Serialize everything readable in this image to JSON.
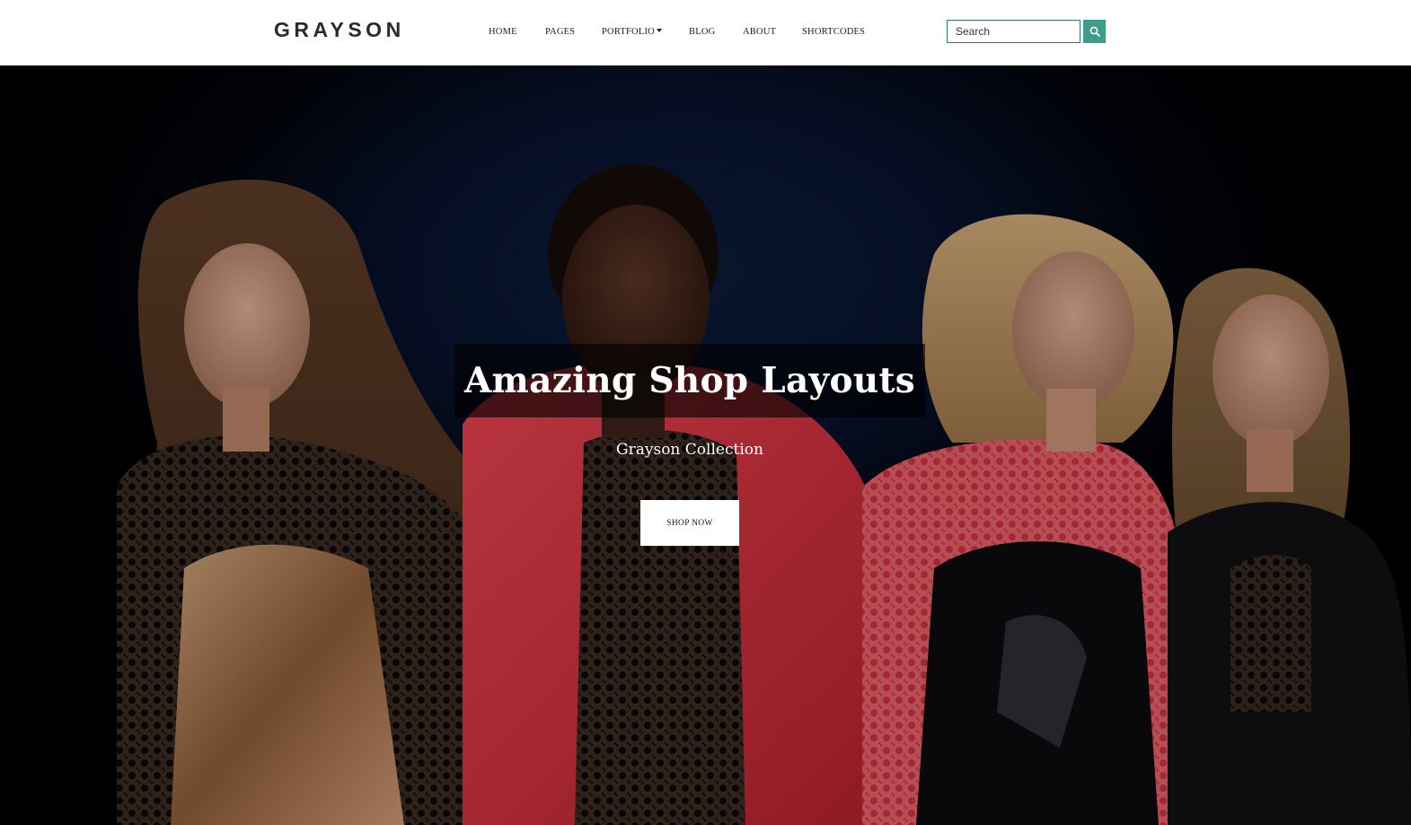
{
  "brand": {
    "logo": "GRAYSON"
  },
  "nav": {
    "items": [
      {
        "label": "HOME"
      },
      {
        "label": "PAGES"
      },
      {
        "label": "PORTFOLIO"
      },
      {
        "label": "BLOG"
      },
      {
        "label": "ABOUT"
      },
      {
        "label": "SHORTCODES"
      }
    ]
  },
  "search": {
    "placeholder": "Search",
    "icon": "search-icon"
  },
  "hero": {
    "title": "Amazing Shop Layouts",
    "subtitle": "Grayson Collection",
    "cta_label": "SHOP NOW",
    "image_subject": "models-photo"
  },
  "colors": {
    "accent": "#3f9c8a",
    "search_border": "#2e7d6f",
    "hero_bg": "#07122b",
    "text_dark": "#1d1d1d"
  }
}
